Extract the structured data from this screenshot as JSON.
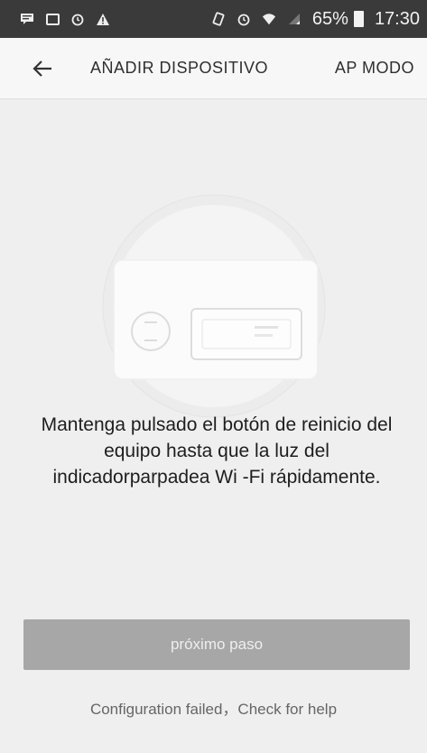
{
  "status_bar": {
    "left_icons": [
      "message-icon",
      "image-icon",
      "alarm-icon",
      "warning-icon"
    ],
    "right_icons": [
      "vibrate-icon",
      "alarm-icon",
      "wifi-icon",
      "signal-icon",
      "battery-icon"
    ],
    "battery_text": "65%",
    "time": "17:30"
  },
  "header": {
    "back_icon": "back-arrow-icon",
    "title": "AÑADIR DISPOSITIVO",
    "mode_label": "AP MODO"
  },
  "illustration": {
    "icon": "device-reset-illustration"
  },
  "instructions": {
    "text": "Mantenga pulsado el botón de reinicio del equipo hasta que la luz del indicadorparpadea Wi -Fi rápidamente."
  },
  "actions": {
    "next_label": "próximo paso",
    "help_text": "Configuration failed，Check for help"
  },
  "colors": {
    "status_bar": "#3a3a3a",
    "background": "#efefef",
    "button": "#a7a7a7"
  }
}
